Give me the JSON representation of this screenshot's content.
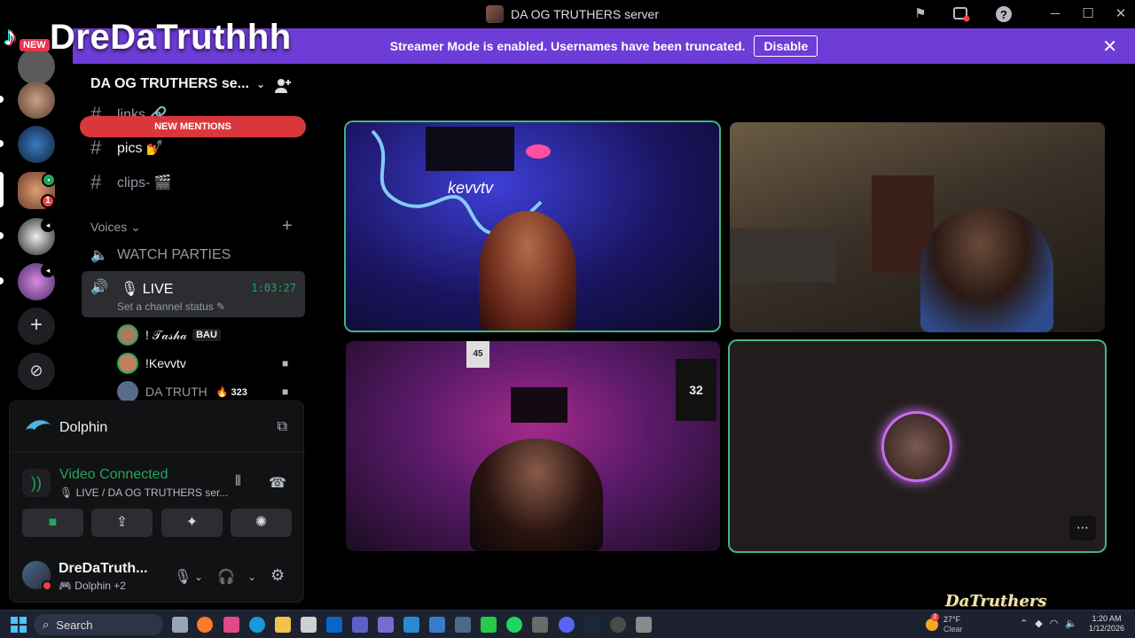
{
  "window": {
    "title": "DA OG TRUTHERS server"
  },
  "overlay": {
    "tiktok_name": "DreDaTruthhh",
    "tiktok_new_label": "NEW"
  },
  "banner": {
    "text": "Streamer Mode is enabled. Usernames have been truncated.",
    "disable_label": "Disable"
  },
  "rail": {
    "badge_count": "1"
  },
  "sidebar": {
    "server_name": "DA OG TRUTHERS se...",
    "new_mentions": "NEW MENTIONS",
    "channels": [
      {
        "label": "links 🔗"
      },
      {
        "label": "pics 💅"
      },
      {
        "label": "clips- 🎬"
      }
    ],
    "voices_label": "Voices",
    "watch_parties": "WATCH PARTIES",
    "live": {
      "label": "🎙 LIVE",
      "timer": "1:03:27",
      "status": "Set a channel status ✎"
    },
    "members": [
      {
        "name": "! 𝒯𝒶𝓈𝒽𝒶",
        "tag": "BAU"
      },
      {
        "name": "!Kevvtv"
      },
      {
        "name": "DA TRUTH",
        "tag": "🔥 323"
      }
    ]
  },
  "panel": {
    "activity": "Dolphin",
    "connection_title": "Video Connected",
    "connection_sub": "🎙 LIVE / DA OG TRUTHERS ser...",
    "user_name": "DreDaTruth...",
    "user_status": "🎮 Dolphin +2"
  },
  "taskbar": {
    "search_label": "Search",
    "temp": "27°F",
    "condition": "Clear",
    "weather_badge": "2",
    "time": "1:20 AM",
    "date": "1/12/2026"
  },
  "watermark_logo": "DaTruthers",
  "colors": {
    "banner": "#6e3cd6",
    "new_mentions": "#da373c",
    "speaking": "#43b581",
    "connected": "#23a55a",
    "ring": "#c86ef0"
  },
  "icons": [
    "flag-icon",
    "snapshot-icon",
    "help-icon",
    "minimize-icon",
    "maximize-icon",
    "close-icon",
    "add-member-icon",
    "speaker-icon",
    "camera-icon",
    "screen-share-icon",
    "activity-icon",
    "soundboard-icon",
    "mic-icon",
    "headphones-icon",
    "settings-icon",
    "hangup-icon",
    "noise-icon",
    "search-icon"
  ]
}
